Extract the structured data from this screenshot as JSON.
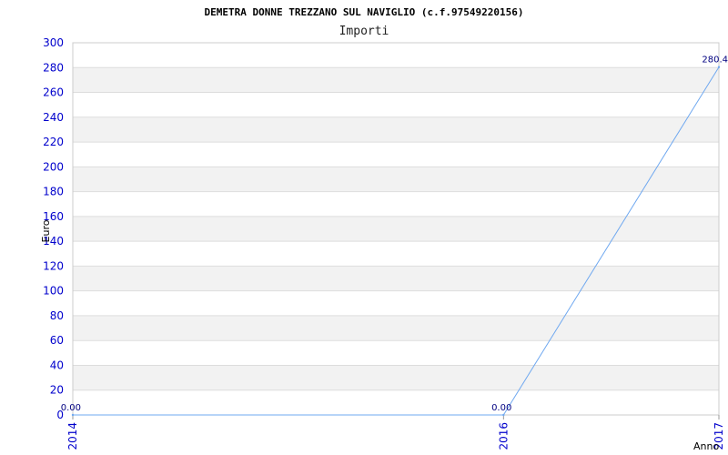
{
  "chart_data": {
    "type": "line",
    "title": "DEMETRA DONNE TREZZANO SUL NAVIGLIO (c.f.97549220156)",
    "subtitle": "Importi",
    "xlabel": "Anno",
    "ylabel": "Euro",
    "x": [
      "2014",
      "2016",
      "2017"
    ],
    "values": [
      0,
      0,
      280.4
    ],
    "data_labels": [
      "0.00",
      "0.00",
      "280.4"
    ],
    "ylim": [
      0,
      300
    ],
    "yticks": [
      0,
      20,
      40,
      60,
      80,
      100,
      120,
      140,
      160,
      180,
      200,
      220,
      240,
      260,
      280,
      300
    ],
    "grid": true,
    "legend": "none",
    "colors": {
      "line": "#6fa8f0",
      "band": "#f2f2f2",
      "gridline": "#dddddd",
      "tick_text": "#0000cc",
      "data_label": "#000080"
    }
  }
}
